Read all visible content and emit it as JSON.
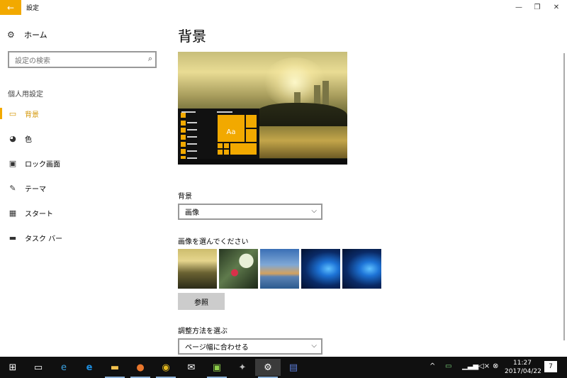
{
  "window": {
    "back_icon": "←",
    "title": "設定",
    "controls": [
      "—",
      "❐",
      "✕"
    ]
  },
  "sidebar": {
    "home": {
      "icon": "gear-icon",
      "label": "ホーム"
    },
    "search_placeholder": "設定の検索",
    "section": "個人用設定",
    "items": [
      {
        "label": "背景",
        "icon": "picture-icon",
        "active": true
      },
      {
        "label": "色",
        "icon": "palette-icon",
        "active": false
      },
      {
        "label": "ロック画面",
        "icon": "lock-screen-icon",
        "active": false
      },
      {
        "label": "テーマ",
        "icon": "brush-icon",
        "active": false
      },
      {
        "label": "スタート",
        "icon": "start-icon",
        "active": false
      },
      {
        "label": "タスク バー",
        "icon": "taskbar-icon",
        "active": false
      }
    ]
  },
  "main": {
    "title": "背景",
    "preview_tile_text": "Aa",
    "background_label": "背景",
    "background_value": "画像",
    "choose_image_label": "画像を選んでください",
    "browse_button": "参照",
    "fit_label": "調整方法を選ぶ",
    "fit_value": "ページ幅に合わせる"
  },
  "taskbar": {
    "clock_time": "11:27",
    "clock_date": "2017/04/22",
    "notification_count": "7",
    "icons": [
      "windows-start-icon",
      "task-view-icon",
      "ie-icon",
      "edge-icon",
      "file-explorer-icon",
      "firefox-icon",
      "chrome-icon",
      "mail-icon",
      "app-icon",
      "app-icon-2",
      "settings-icon",
      "app-icon-3"
    ]
  },
  "colors": {
    "accent": "#f2a900",
    "taskbar": "#101010"
  }
}
